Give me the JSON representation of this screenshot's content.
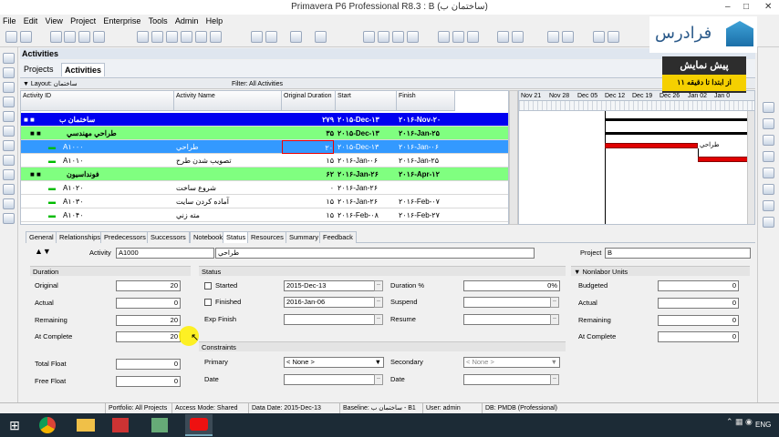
{
  "window": {
    "title": "Primavera P6 Professional R8.3 : B (ساختمان ب)"
  },
  "menu": [
    "File",
    "Edit",
    "View",
    "Project",
    "Enterprise",
    "Tools",
    "Admin",
    "Help"
  ],
  "pane": {
    "title": "Activities"
  },
  "tabs": {
    "projects": "Projects",
    "activities": "Activities"
  },
  "layout": {
    "label": "Layout: ساختمان",
    "filter": "Filter: All Activities"
  },
  "grid": {
    "headers": {
      "id": "Activity ID",
      "name": "Activity Name",
      "orig": "Original Duration",
      "start": "Start",
      "finish": "Finish"
    },
    "rows": [
      {
        "id": "ساختمان ب",
        "name": "",
        "orig": "۲۷۹",
        "start": "۲۰۱۵-Dec-۱۳",
        "finish": "۲۰۱۶-Nov-۲۰",
        "kind": "project"
      },
      {
        "id": "طراحي مهندسي",
        "name": "",
        "orig": "۳۵",
        "start": "۲۰۱۵-Dec-۱۳",
        "finish": "۲۰۱۶-Jan-۲۵",
        "kind": "wbs"
      },
      {
        "id": "A۱۰۰۰",
        "name": "طراحي",
        "orig": "۲۰",
        "start": "۲۰۱۵-Dec-۱۳",
        "finish": "۲۰۱۶-Jan-۰۶",
        "kind": "selected"
      },
      {
        "id": "A۱۰۱۰",
        "name": "تصويب شدن طرح",
        "orig": "۱۵",
        "start": "۲۰۱۶-Jan-۰۶",
        "finish": "۲۰۱۶-Jan-۲۵",
        "kind": "activity"
      },
      {
        "id": "فونداسيون",
        "name": "",
        "orig": "۶۲",
        "start": "۲۰۱۶-Jan-۲۶",
        "finish": "۲۰۱۶-Apr-۱۲",
        "kind": "wbs"
      },
      {
        "id": "A۱۰۲۰",
        "name": "شروع ساخت",
        "orig": "۰",
        "start": "۲۰۱۶-Jan-۲۶",
        "finish": "",
        "kind": "activity"
      },
      {
        "id": "A۱۰۳۰",
        "name": "آماده کردن سايت",
        "orig": "۱۵",
        "start": "۲۰۱۶-Jan-۲۶",
        "finish": "۲۰۱۶-Feb-۰۷",
        "kind": "activity"
      },
      {
        "id": "A۱۰۴۰",
        "name": "مته زني",
        "orig": "۱۵",
        "start": "۲۰۱۶-Feb-۰۸",
        "finish": "۲۰۱۶-Feb-۲۷",
        "kind": "activity"
      }
    ]
  },
  "gantt": {
    "columns": [
      "Nov 21",
      "Nov 28",
      "Dec 05",
      "Dec 12",
      "Dec 19",
      "Dec 26",
      "Jan 02",
      "Jan 0"
    ],
    "bar_label": "طراحي"
  },
  "detail_tabs": [
    "General",
    "Relationships",
    "Predecessors",
    "Successors",
    "Notebook",
    "Status",
    "Resources",
    "Summary",
    "Feedback"
  ],
  "detail": {
    "activity_label": "Activity",
    "activity_id": "A1000",
    "activity_name": "طراحي",
    "project_label": "Project",
    "project_value": "B",
    "duration": {
      "title": "Duration",
      "original_label": "Original",
      "original": "20",
      "actual_label": "Actual",
      "actual": "0",
      "remaining_label": "Remaining",
      "remaining": "20",
      "at_complete_label": "At Complete",
      "at_complete": "20"
    },
    "float": {
      "total_label": "Total Float",
      "total": "0",
      "free_label": "Free Float",
      "free": "0"
    },
    "status": {
      "title": "Status",
      "started_label": "Started",
      "started": "2015-Dec-13",
      "finished_label": "Finished",
      "finished": "2016-Jan-06",
      "exp_finish_label": "Exp Finish",
      "duration_pct_label": "Duration %",
      "duration_pct": "0%",
      "suspend_label": "Suspend",
      "resume_label": "Resume"
    },
    "constraints": {
      "title": "Constraints",
      "primary_label": "Primary",
      "primary": "< None >",
      "secondary_label": "Secondary",
      "secondary": "< None >",
      "date_label": "Date",
      "date2_label": "Date"
    },
    "nonlabor": {
      "title": "Nonlabor Units",
      "budgeted_label": "Budgeted",
      "budgeted": "0",
      "actual_label": "Actual",
      "actual": "0",
      "remaining_label": "Remaining",
      "remaining": "0",
      "at_complete_label": "At Complete",
      "at_complete": "0"
    }
  },
  "statusbar": {
    "portfolio": "Portfolio: All Projects",
    "access": "Access Mode: Shared",
    "data_date": "Data Date: 2015-Dec-13",
    "baseline": "Baseline: ساختمان ب - B1",
    "user": "User: admin",
    "db": "DB: PMDB (Professional)"
  },
  "taskbar": {
    "lang": "ENG"
  },
  "overlay": {
    "brand": "فرادرس",
    "promo_title": "پيش نمايش",
    "promo_sub": "از ابتدا تا دقيقه ۱۱"
  },
  "colors": {
    "project_row": "#0000f0",
    "wbs_row": "#80ff80",
    "selected_row": "#3399ff",
    "gantt_bar": "#e00000"
  }
}
